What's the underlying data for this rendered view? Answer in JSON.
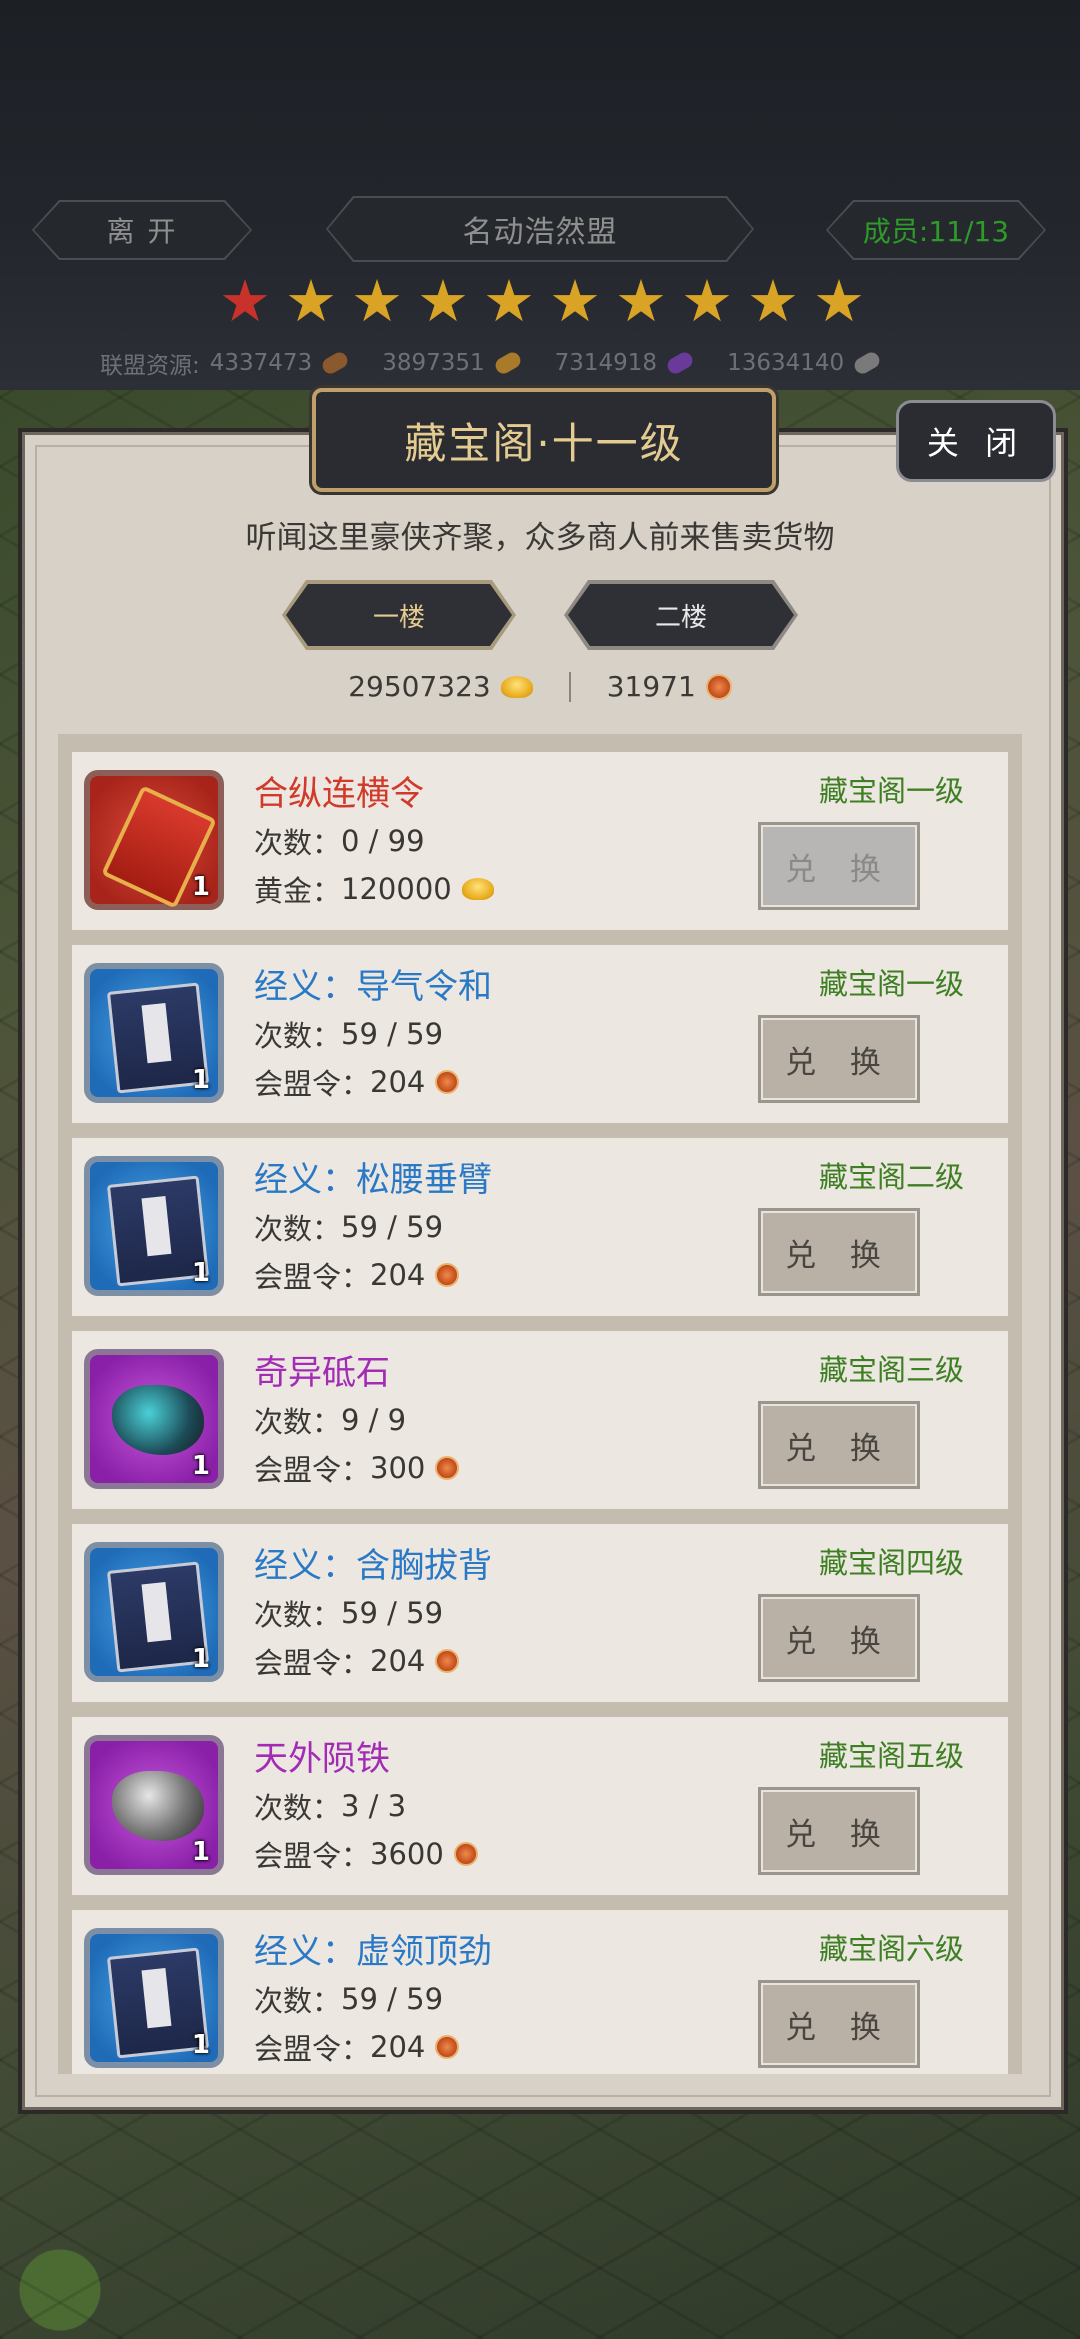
{
  "topbar": {
    "leave_label": "离 开",
    "alliance_name": "名动浩然盟",
    "members_label": "成员:11/13",
    "stars_total": 10,
    "stars_red": 1,
    "resources_label": "联盟资源:",
    "resources": [
      "4337473",
      "3897351",
      "7314918",
      "13634140"
    ]
  },
  "panel": {
    "title": "藏宝阁·十一级",
    "close_label": "关 闭",
    "subtitle": "听闻这里豪侠齐聚，众多商人前来售卖货物",
    "floors": [
      "一楼",
      "二楼"
    ],
    "gold_amount": "29507323",
    "token_amount": "31971"
  },
  "items": [
    {
      "name": "合纵连横令",
      "color": "red",
      "frame": "red",
      "art": "token-card",
      "count_label": "次数：",
      "count": "0 / 99",
      "cost_label": "黄金：",
      "cost": "120000",
      "cost_icon": "gold",
      "level": "藏宝阁一级",
      "button": "兑 换",
      "disabled": true,
      "qty": "1"
    },
    {
      "name": "经义：导气令和",
      "color": "blue",
      "frame": "blue",
      "art": "book",
      "count_label": "次数：",
      "count": "59 / 59",
      "cost_label": "会盟令：",
      "cost": "204",
      "cost_icon": "token",
      "level": "藏宝阁一级",
      "button": "兑 换",
      "disabled": false,
      "qty": "1"
    },
    {
      "name": "经义：松腰垂臂",
      "color": "blue",
      "frame": "blue",
      "art": "book",
      "count_label": "次数：",
      "count": "59 / 59",
      "cost_label": "会盟令：",
      "cost": "204",
      "cost_icon": "token",
      "level": "藏宝阁二级",
      "button": "兑 换",
      "disabled": false,
      "qty": "1"
    },
    {
      "name": "奇异砥石",
      "color": "purple",
      "frame": "purple",
      "art": "rock-teal",
      "count_label": "次数：",
      "count": "9 / 9",
      "cost_label": "会盟令：",
      "cost": "300",
      "cost_icon": "token",
      "level": "藏宝阁三级",
      "button": "兑 换",
      "disabled": false,
      "qty": "1"
    },
    {
      "name": "经义：含胸拔背",
      "color": "blue",
      "frame": "blue",
      "art": "book",
      "count_label": "次数：",
      "count": "59 / 59",
      "cost_label": "会盟令：",
      "cost": "204",
      "cost_icon": "token",
      "level": "藏宝阁四级",
      "button": "兑 换",
      "disabled": false,
      "qty": "1"
    },
    {
      "name": "天外陨铁",
      "color": "purple",
      "frame": "purple",
      "art": "rock-grey",
      "count_label": "次数：",
      "count": "3 / 3",
      "cost_label": "会盟令：",
      "cost": "3600",
      "cost_icon": "token",
      "level": "藏宝阁五级",
      "button": "兑 换",
      "disabled": false,
      "qty": "1"
    },
    {
      "name": "经义：虚领顶劲",
      "color": "blue",
      "frame": "blue",
      "art": "book",
      "count_label": "次数：",
      "count": "59 / 59",
      "cost_label": "会盟令：",
      "cost": "204",
      "cost_icon": "token",
      "level": "藏宝阁六级",
      "button": "兑 换",
      "disabled": false,
      "qty": "1"
    }
  ],
  "colors": {
    "accent_gold": "#e4cb8f",
    "members_green": "#2e9a2a",
    "level_green": "#3f7f24"
  }
}
